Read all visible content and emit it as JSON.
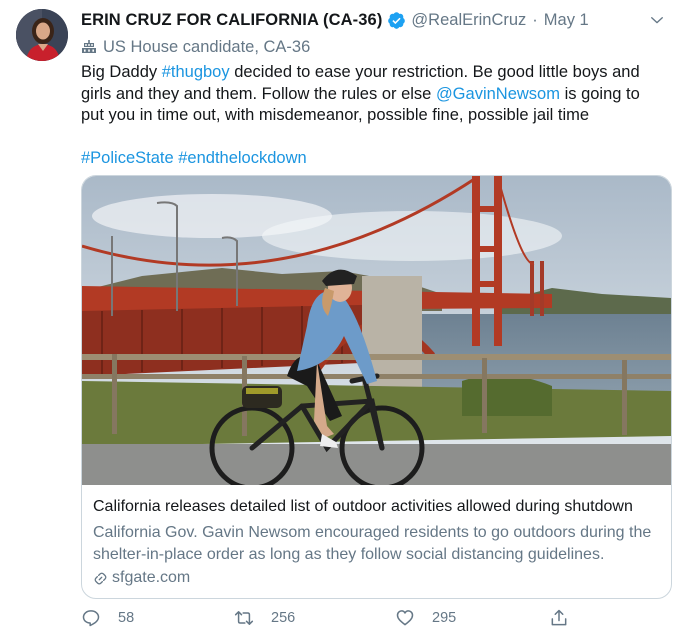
{
  "tweet": {
    "author_name": "ERIN CRUZ FOR CALIFORNIA (CA-36)",
    "handle": "@RealErinCruz",
    "separator": "·",
    "date": "May 1",
    "verified": true,
    "label_icon": "building-icon",
    "label": "US House candidate, CA-36",
    "text": {
      "seg1": "Big Daddy ",
      "hashtag_thugboy": "#thugboy",
      "seg2": " decided to ease your restriction. Be good little boys and girls and they and them. Follow the rules or else ",
      "mention": "@GavinNewsom",
      "seg3": " is going to put you in time out, with misdemeanor, possible fine, possible jail time",
      "hashtag_police": "#PoliceState",
      "space": " ",
      "hashtag_lockdown": "#endthelockdown"
    },
    "card": {
      "title": "California releases detailed list of outdoor activities allowed during shutdown",
      "description": "California Gov. Gavin Newsom encouraged residents to go outdoors during the shelter-in-place order as long as they follow social distancing guidelines.",
      "domain": "sfgate.com",
      "image_icon": "golden-gate-cyclist-photo"
    },
    "actions": {
      "reply_count": "58",
      "retweet_count": "256",
      "like_count": "295"
    },
    "colors": {
      "link": "#1b95e0",
      "secondary_text": "#657786",
      "verified": "#1da1f2",
      "border": "#ccd6dd"
    }
  }
}
